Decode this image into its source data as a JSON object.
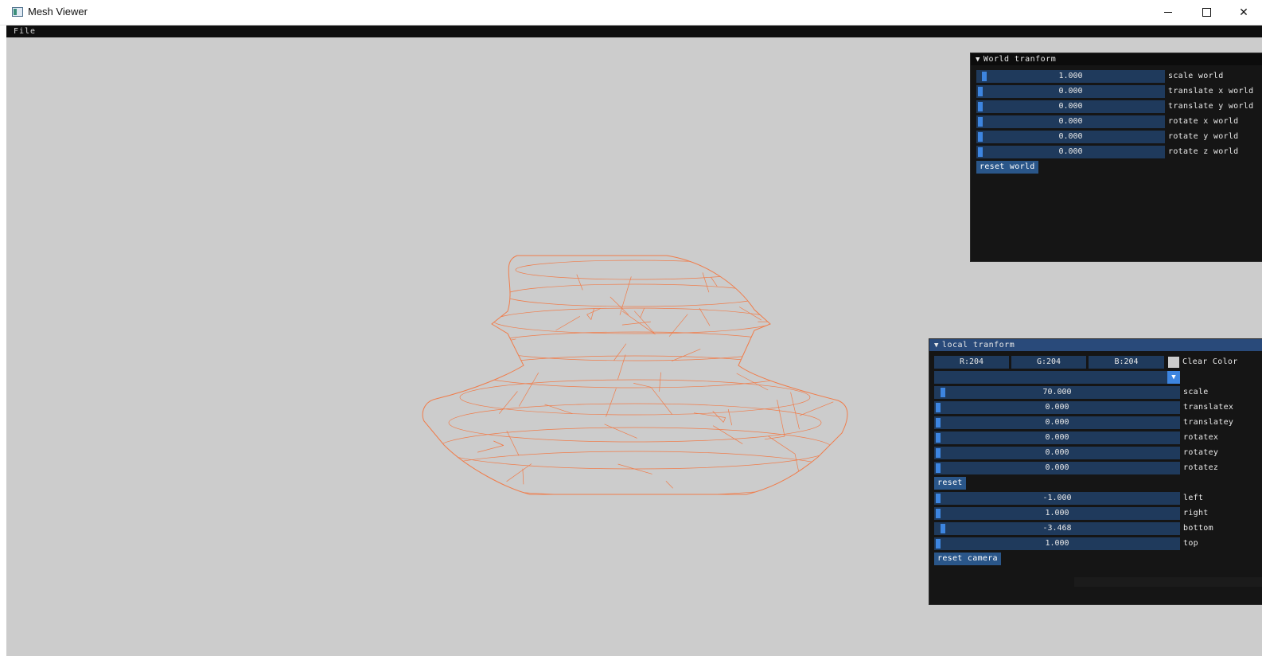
{
  "window": {
    "title": "Mesh Viewer",
    "minimize_icon": "minimize-icon",
    "maximize_icon": "maximize-icon",
    "close_icon": "close-icon",
    "close_glyph": "✕"
  },
  "menu": {
    "file_label": "File"
  },
  "viewport": {
    "clear_color": "#cccccc",
    "wire_color": "#f07c4a"
  },
  "world_panel": {
    "title": "World tranform",
    "sliders": [
      {
        "value": "1.000",
        "label": "scale world",
        "level": 0.02
      },
      {
        "value": "0.000",
        "label": "translate x world",
        "level": 0.0
      },
      {
        "value": "0.000",
        "label": "translate y world",
        "level": 0.0
      },
      {
        "value": "0.000",
        "label": "rotate x world",
        "level": 0.0
      },
      {
        "value": "0.000",
        "label": "rotate y world",
        "level": 0.0
      },
      {
        "value": "0.000",
        "label": "rotate z world",
        "level": 0.0
      }
    ],
    "reset_label": "reset world"
  },
  "local_panel": {
    "title": "local tranform",
    "color": {
      "r": "R:204",
      "g": "G:204",
      "b": "B:204",
      "label": "Clear Color",
      "swatch": "#cccccc"
    },
    "combo_arrow": "▼",
    "sliders": [
      {
        "value": "70.000",
        "label": "scale",
        "level": 0.02
      },
      {
        "value": "0.000",
        "label": "translatex",
        "level": 0.0
      },
      {
        "value": "0.000",
        "label": "translatey",
        "level": 0.0
      },
      {
        "value": "0.000",
        "label": "rotatex",
        "level": 0.0
      },
      {
        "value": "0.000",
        "label": "rotatey",
        "level": 0.0
      },
      {
        "value": "0.000",
        "label": "rotatez",
        "level": 0.0
      }
    ],
    "reset_label": "reset",
    "camera_sliders": [
      {
        "value": "-1.000",
        "label": "left",
        "level": 0.0
      },
      {
        "value": "1.000",
        "label": "right",
        "level": 0.0
      },
      {
        "value": "-3.468",
        "label": "bottom",
        "level": 0.02
      },
      {
        "value": "1.000",
        "label": "top",
        "level": 0.0
      }
    ],
    "reset_camera_label": "reset camera"
  }
}
